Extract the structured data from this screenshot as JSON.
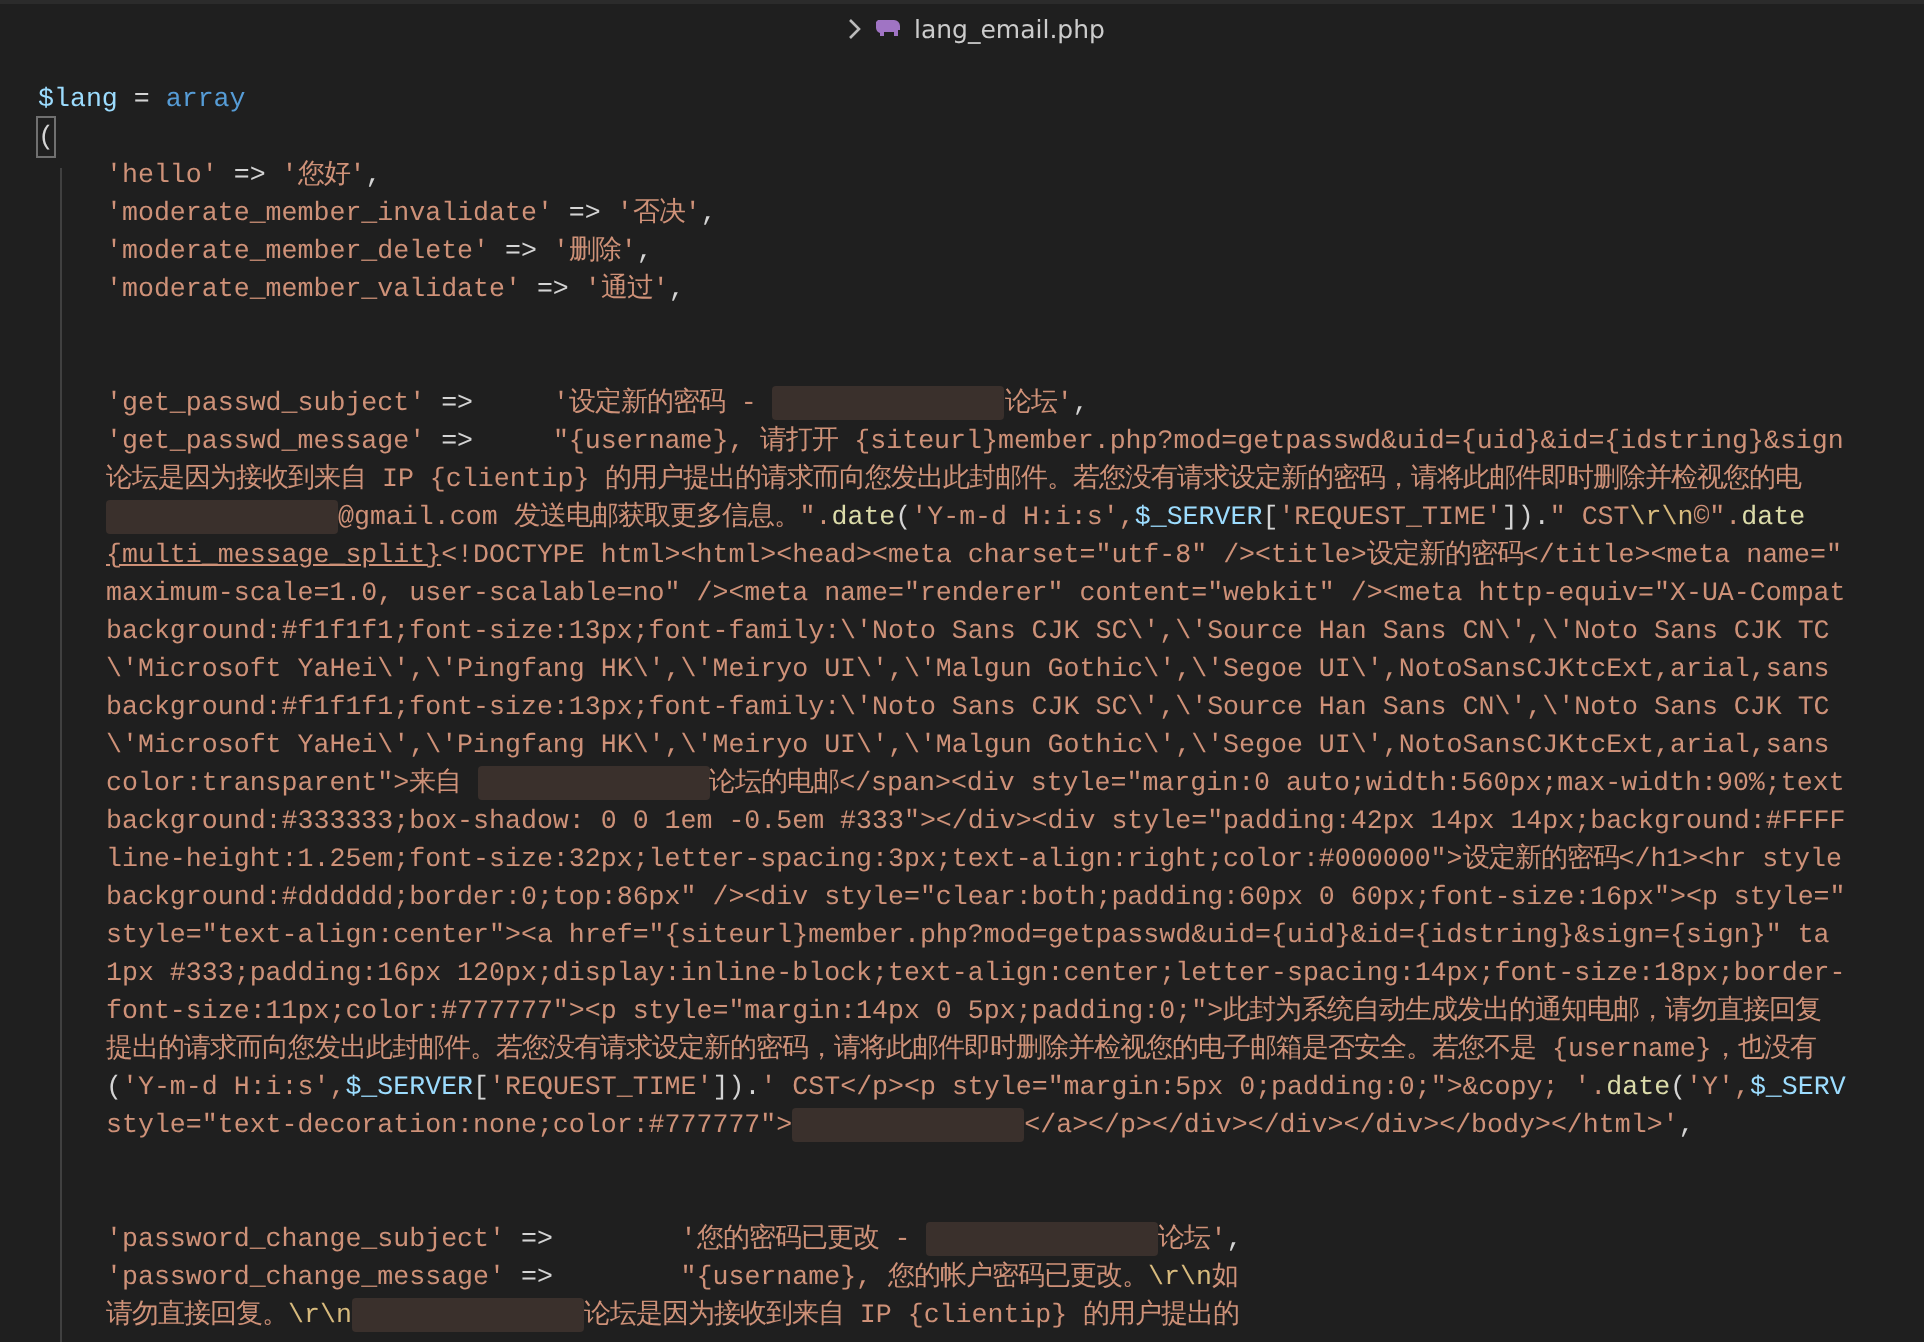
{
  "breadcrumb": {
    "file_name": "lang_email.php"
  },
  "header_lines": [
    {
      "tokens": [
        {
          "kind": "var",
          "text": "$lang"
        },
        {
          "kind": "op",
          "text": " = "
        },
        {
          "kind": "kw",
          "text": "array"
        }
      ]
    },
    {
      "tokens": [
        {
          "kind": "bracket",
          "text": "("
        }
      ]
    }
  ],
  "array_body_lines": [
    {
      "tokens": [
        {
          "kind": "str",
          "text": "'hello'"
        },
        {
          "kind": "op",
          "text": " => "
        },
        {
          "kind": "str",
          "text": "'您好'"
        },
        {
          "kind": "op",
          "text": ","
        }
      ]
    },
    {
      "tokens": [
        {
          "kind": "str",
          "text": "'moderate_member_invalidate'"
        },
        {
          "kind": "op",
          "text": " => "
        },
        {
          "kind": "str",
          "text": "'否决'"
        },
        {
          "kind": "op",
          "text": ","
        }
      ]
    },
    {
      "tokens": [
        {
          "kind": "str",
          "text": "'moderate_member_delete'"
        },
        {
          "kind": "op",
          "text": " => "
        },
        {
          "kind": "str",
          "text": "'删除'"
        },
        {
          "kind": "op",
          "text": ","
        }
      ]
    },
    {
      "tokens": [
        {
          "kind": "str",
          "text": "'moderate_member_validate'"
        },
        {
          "kind": "op",
          "text": " => "
        },
        {
          "kind": "str",
          "text": "'通过'"
        },
        {
          "kind": "op",
          "text": ","
        }
      ]
    },
    {
      "tokens": [
        {
          "kind": "blank"
        }
      ]
    },
    {
      "tokens": [
        {
          "kind": "blank"
        }
      ]
    },
    {
      "tokens": [
        {
          "kind": "str",
          "text": "'get_passwd_subject'"
        },
        {
          "kind": "op",
          "text": " =>     "
        },
        {
          "kind": "str",
          "text": "'设定新的密码 - "
        },
        {
          "kind": "redacted"
        },
        {
          "kind": "str",
          "text": "论坛'"
        },
        {
          "kind": "op",
          "text": ","
        }
      ]
    },
    {
      "tokens": [
        {
          "kind": "str",
          "text": "'get_passwd_message'"
        },
        {
          "kind": "op",
          "text": " =>     "
        },
        {
          "kind": "str",
          "text": "\"{username}, 请打开 {siteurl}member.php?mod=getpasswd&uid={uid}&id={idstring}&sign"
        }
      ]
    },
    {
      "tokens": [
        {
          "kind": "str",
          "text": "论坛是因为接收到来自 IP {clientip} 的用户提出的请求而向您发出此封邮件。若您没有请求设定新的密码，请将此邮件即时删除并检视您的电"
        }
      ]
    },
    {
      "tokens": [
        {
          "kind": "redacted"
        },
        {
          "kind": "str",
          "text": "@gmail.com 发送电邮获取更多信息。\"."
        },
        {
          "kind": "fn",
          "text": "date"
        },
        {
          "kind": "op",
          "text": "("
        },
        {
          "kind": "str",
          "text": "'Y-m-d H:i:s',"
        },
        {
          "kind": "var",
          "text": "$_SERVER"
        },
        {
          "kind": "op",
          "text": "["
        },
        {
          "kind": "str",
          "text": "'REQUEST_TIME'"
        },
        {
          "kind": "op",
          "text": "])."
        },
        {
          "kind": "str",
          "text": "\" CST"
        },
        {
          "kind": "esc",
          "text": "\\r\\n"
        },
        {
          "kind": "str",
          "text": "©\"."
        },
        {
          "kind": "fn",
          "text": "date"
        }
      ]
    },
    {
      "tokens": [
        {
          "kind": "link",
          "text": "{multi_message_split}"
        },
        {
          "kind": "str",
          "text": "<!DOCTYPE html><html><head><meta charset=\"utf-8\" /><title>设定新的密码</title><meta name=\""
        }
      ]
    },
    {
      "tokens": [
        {
          "kind": "str",
          "text": "maximum-scale=1.0, user-scalable=no\" /><meta name=\"renderer\" content=\"webkit\" /><meta http-equiv=\"X-UA-Compat"
        }
      ]
    },
    {
      "tokens": [
        {
          "kind": "str",
          "text": "background:#f1f1f1;font-size:13px;font-family:\\'Noto Sans CJK SC\\',\\'Source Han Sans CN\\',\\'Noto Sans CJK TC"
        }
      ]
    },
    {
      "tokens": [
        {
          "kind": "str",
          "text": "\\'Microsoft YaHei\\',\\'Pingfang HK\\',\\'Meiryo UI\\',\\'Malgun Gothic\\',\\'Segoe UI\\',NotoSansCJKtcExt,arial,sans"
        }
      ]
    },
    {
      "tokens": [
        {
          "kind": "str",
          "text": "background:#f1f1f1;font-size:13px;font-family:\\'Noto Sans CJK SC\\',\\'Source Han Sans CN\\',\\'Noto Sans CJK TC"
        }
      ]
    },
    {
      "tokens": [
        {
          "kind": "str",
          "text": "\\'Microsoft YaHei\\',\\'Pingfang HK\\',\\'Meiryo UI\\',\\'Malgun Gothic\\',\\'Segoe UI\\',NotoSansCJKtcExt,arial,sans"
        }
      ]
    },
    {
      "tokens": [
        {
          "kind": "str",
          "text": "color:transparent\">来自 "
        },
        {
          "kind": "redacted"
        },
        {
          "kind": "str",
          "text": "论坛的电邮</span><div style=\"margin:0 auto;width:560px;max-width:90%;text"
        }
      ]
    },
    {
      "tokens": [
        {
          "kind": "str",
          "text": "background:#333333;box-shadow: 0 0 1em -0.5em #333\"></div><div style=\"padding:42px 14px 14px;background:#FFFF"
        }
      ]
    },
    {
      "tokens": [
        {
          "kind": "str",
          "text": "line-height:1.25em;font-size:32px;letter-spacing:3px;text-align:right;color:#000000\">设定新的密码</h1><hr style"
        }
      ]
    },
    {
      "tokens": [
        {
          "kind": "str",
          "text": "background:#dddddd;border:0;top:86px\" /><div style=\"clear:both;padding:60px 0 60px;font-size:16px\"><p style=\""
        }
      ]
    },
    {
      "tokens": [
        {
          "kind": "str",
          "text": "style=\"text-align:center\"><a href=\"{siteurl}member.php?mod=getpasswd&uid={uid}&id={idstring}&sign={sign}\" ta"
        }
      ]
    },
    {
      "tokens": [
        {
          "kind": "str",
          "text": "1px #333;padding:16px 120px;display:inline-block;text-align:center;letter-spacing:14px;font-size:18px;border-"
        }
      ]
    },
    {
      "tokens": [
        {
          "kind": "str",
          "text": "font-size:11px;color:#777777\"><p style=\"margin:14px 0 5px;padding:0;\">此封为系统自动生成发出的通知电邮，请勿直接回复"
        }
      ]
    },
    {
      "tokens": [
        {
          "kind": "str",
          "text": "提出的请求而向您发出此封邮件。若您没有请求设定新的密码，请将此邮件即时删除并检视您的电子邮箱是否安全。若您不是 {username}，也没有"
        }
      ]
    },
    {
      "tokens": [
        {
          "kind": "op",
          "text": "("
        },
        {
          "kind": "str",
          "text": "'Y-m-d H:i:s',"
        },
        {
          "kind": "var",
          "text": "$_SERVER"
        },
        {
          "kind": "op",
          "text": "["
        },
        {
          "kind": "str",
          "text": "'REQUEST_TIME'"
        },
        {
          "kind": "op",
          "text": "])."
        },
        {
          "kind": "str",
          "text": "' CST</p><p style=\"margin:5px 0;padding:0;\">&copy; '."
        },
        {
          "kind": "fn",
          "text": "date"
        },
        {
          "kind": "op",
          "text": "("
        },
        {
          "kind": "str",
          "text": "'Y',"
        },
        {
          "kind": "var",
          "text": "$_SERV"
        }
      ]
    },
    {
      "tokens": [
        {
          "kind": "str",
          "text": "style=\"text-decoration:none;color:#777777\">"
        },
        {
          "kind": "redacted"
        },
        {
          "kind": "str",
          "text": "</a></p></div></div></div></body></html>'"
        },
        {
          "kind": "op",
          "text": ","
        }
      ]
    },
    {
      "tokens": [
        {
          "kind": "blank"
        }
      ]
    },
    {
      "tokens": [
        {
          "kind": "blank"
        }
      ]
    },
    {
      "tokens": [
        {
          "kind": "str",
          "text": "'password_change_subject'"
        },
        {
          "kind": "op",
          "text": " =>        "
        },
        {
          "kind": "str",
          "text": "'您的密码已更改 - "
        },
        {
          "kind": "redacted"
        },
        {
          "kind": "str",
          "text": "论坛'"
        },
        {
          "kind": "op",
          "text": ","
        }
      ]
    },
    {
      "tokens": [
        {
          "kind": "str",
          "text": "'password_change_message'"
        },
        {
          "kind": "op",
          "text": " =>        "
        },
        {
          "kind": "str",
          "text": "\"{username}, 您的帐户密码已更改。"
        },
        {
          "kind": "esc",
          "text": "\\r\\n"
        },
        {
          "kind": "str",
          "text": "如"
        }
      ]
    },
    {
      "tokens": [
        {
          "kind": "str",
          "text": "请勿直接回复。"
        },
        {
          "kind": "esc",
          "text": "\\r\\n"
        },
        {
          "kind": "redacted"
        },
        {
          "kind": "str",
          "text": "论坛是因为接收到来自 IP {clientip} 的用户提出的"
        }
      ]
    }
  ]
}
